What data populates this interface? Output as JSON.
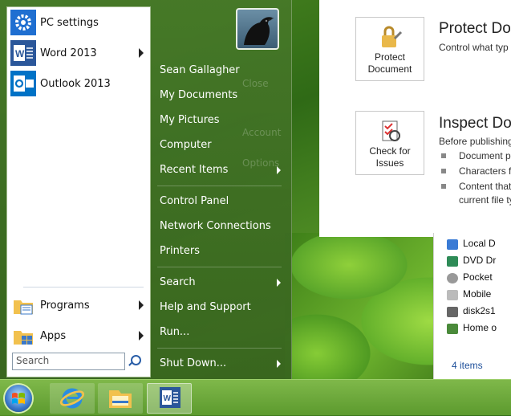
{
  "start_menu": {
    "pinned": [
      {
        "label": "PC settings",
        "icon": "gear-icon",
        "tile_color": "#1f6fd1",
        "has_arrow": false
      },
      {
        "label": "Word 2013",
        "icon": "word-icon",
        "tile_color": "#2b579a",
        "has_arrow": true
      },
      {
        "label": "Outlook 2013",
        "icon": "outlook-icon",
        "tile_color": "#0072c6",
        "has_arrow": false
      }
    ],
    "bottom": [
      {
        "label": "Programs",
        "icon": "programs-folder-icon"
      },
      {
        "label": "Apps",
        "icon": "apps-folder-icon"
      }
    ],
    "search_placeholder": "Search",
    "user": "Sean Gallagher",
    "right_links": [
      {
        "label": "My Documents",
        "arrow": false
      },
      {
        "label": "My Pictures",
        "arrow": false
      },
      {
        "label": "Computer",
        "arrow": false
      },
      {
        "label": "Recent Items",
        "arrow": true
      },
      {
        "label": "Control Panel",
        "arrow": false
      },
      {
        "label": "Network Connections",
        "arrow": false
      },
      {
        "label": "Printers",
        "arrow": false
      },
      {
        "label": "Search",
        "arrow": true
      },
      {
        "label": "Help and Support",
        "arrow": false
      },
      {
        "label": "Run...",
        "arrow": false
      }
    ],
    "shutdown": "Shut Down..."
  },
  "word_backstage": {
    "ghost": [
      "Close",
      "Account",
      "Options"
    ],
    "protect": {
      "button": "Protect Document",
      "title": "Protect Doc",
      "desc": "Control what typ"
    },
    "inspect": {
      "button": "Check for Issues",
      "title": "Inspect Doc",
      "desc": "Before publishing",
      "bullets": [
        "Document p",
        "Characters fo",
        "Content that",
        "current file ty"
      ]
    }
  },
  "explorer": {
    "items": [
      "Local D",
      "DVD Dr",
      "Pocket",
      "Mobile",
      "disk2s1",
      "Home o"
    ],
    "count": "4 items"
  },
  "taskbar": [
    "start-button",
    "internet-explorer",
    "file-explorer",
    "word"
  ],
  "colors": {
    "accent": "#2b579a",
    "menu_green": "#3f7a22"
  }
}
